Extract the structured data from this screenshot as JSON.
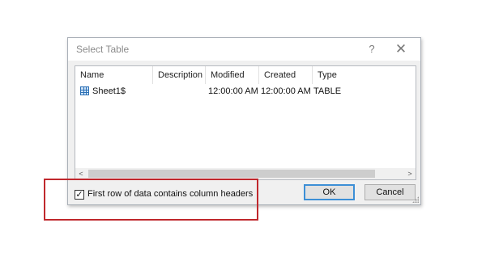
{
  "dialog": {
    "title": "Select Table",
    "help_symbol": "?",
    "close_symbol": "✕"
  },
  "list": {
    "columns": [
      "Name",
      "Description",
      "Modified",
      "Created",
      "Type"
    ],
    "rows": [
      {
        "name": "Sheet1$",
        "description": "",
        "modified": "12:00:00 AM",
        "created": "12:00:00 AM",
        "type": "TABLE",
        "icon": "table-icon"
      }
    ]
  },
  "scrollbar": {
    "left_arrow": "<",
    "right_arrow": ">"
  },
  "options": {
    "first_row_headers_label": "First row of data contains column headers",
    "first_row_headers_checked": true,
    "check_mark": "✓"
  },
  "buttons": {
    "ok_label": "OK",
    "cancel_label": "Cancel"
  },
  "annotation": {
    "highlight_color": "#c0282d"
  }
}
